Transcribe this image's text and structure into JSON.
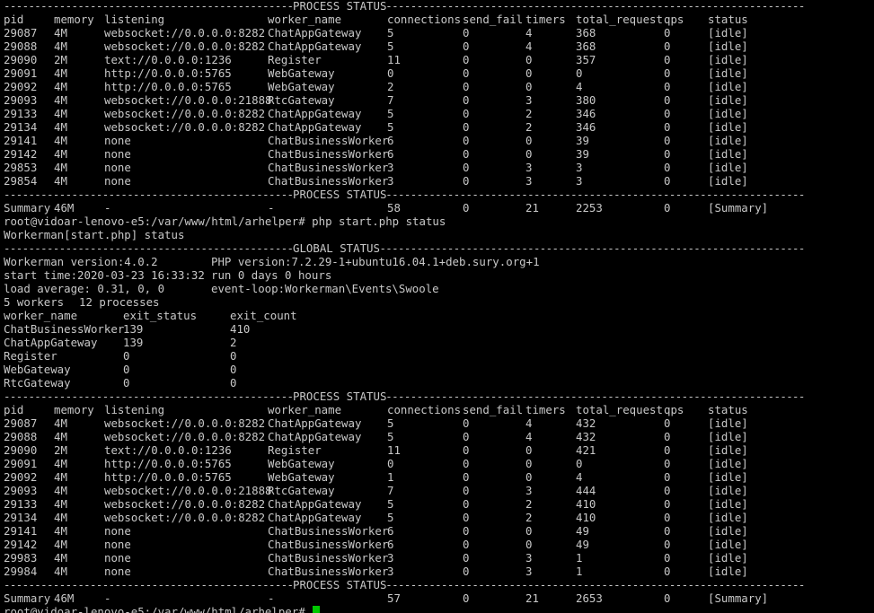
{
  "theme": {
    "background": "#000000",
    "foreground": "#c8c8c8",
    "cursor": "#00c800"
  },
  "process_status_header": "-------------------------------------------------PROCESS STATUS--------------------------------------------------",
  "global_status_header": "-------------------------------------------------GLOBAL STATUS--------------------------------------------------",
  "columns": [
    "pid",
    "memory",
    "listening",
    "worker_name",
    "connections",
    "send_fail",
    "timers",
    "total_request",
    "qps",
    "status"
  ],
  "table1": {
    "rows": [
      [
        "29087",
        "4M",
        "websocket://0.0.0.0:8282",
        "ChatAppGateway",
        "5",
        "0",
        "4",
        "368",
        "0",
        "[idle]"
      ],
      [
        "29088",
        "4M",
        "websocket://0.0.0.0:8282",
        "ChatAppGateway",
        "5",
        "0",
        "4",
        "368",
        "0",
        "[idle]"
      ],
      [
        "29090",
        "2M",
        "text://0.0.0.0:1236",
        "Register",
        "11",
        "0",
        "0",
        "357",
        "0",
        "[idle]"
      ],
      [
        "29091",
        "4M",
        "http://0.0.0.0:5765",
        "WebGateway",
        "0",
        "0",
        "0",
        "0",
        "0",
        "[idle]"
      ],
      [
        "29092",
        "4M",
        "http://0.0.0.0:5765",
        "WebGateway",
        "2",
        "0",
        "0",
        "4",
        "0",
        "[idle]"
      ],
      [
        "29093",
        "4M",
        "websocket://0.0.0.0:21888",
        "RtcGateway",
        "7",
        "0",
        "3",
        "380",
        "0",
        "[idle]"
      ],
      [
        "29133",
        "4M",
        "websocket://0.0.0.0:8282",
        "ChatAppGateway",
        "5",
        "0",
        "2",
        "346",
        "0",
        "[idle]"
      ],
      [
        "29134",
        "4M",
        "websocket://0.0.0.0:8282",
        "ChatAppGateway",
        "5",
        "0",
        "2",
        "346",
        "0",
        "[idle]"
      ],
      [
        "29141",
        "4M",
        "none",
        "ChatBusinessWorker",
        "6",
        "0",
        "0",
        "39",
        "0",
        "[idle]"
      ],
      [
        "29142",
        "4M",
        "none",
        "ChatBusinessWorker",
        "6",
        "0",
        "0",
        "39",
        "0",
        "[idle]"
      ],
      [
        "29853",
        "4M",
        "none",
        "ChatBusinessWorker",
        "3",
        "0",
        "3",
        "3",
        "0",
        "[idle]"
      ],
      [
        "29854",
        "4M",
        "none",
        "ChatBusinessWorker",
        "3",
        "0",
        "3",
        "3",
        "0",
        "[idle]"
      ]
    ],
    "summary": [
      "Summary",
      "46M",
      "-",
      "-",
      "58",
      "0",
      "21",
      "2253",
      "0",
      "[Summary]"
    ]
  },
  "prompt_command": "root@vidoar-lenovo-e5:/var/www/html/arhelper# php start.php status",
  "workerman_status_line": "Workerman[start.php] status",
  "global": {
    "workerman_version": "Workerman version:4.0.2",
    "php_version": "PHP version:7.2.29-1+ubuntu16.04.1+deb.sury.org+1",
    "start_time": "start time:2020-03-23 16:33:32",
    "run_time": "run 0 days 0 hours",
    "load_average": "load average: 0.31, 0, 0",
    "event_loop": "event-loop:Workerman\\Events\\Swoole",
    "workers": "5 workers",
    "processes": "12 processes",
    "exit_columns": [
      "worker_name",
      "exit_status",
      "exit_count"
    ],
    "exit_rows": [
      [
        "ChatBusinessWorker",
        "139",
        "410"
      ],
      [
        "ChatAppGateway",
        "139",
        "2"
      ],
      [
        "Register",
        "0",
        "0"
      ],
      [
        "WebGateway",
        "0",
        "0"
      ],
      [
        "RtcGateway",
        "0",
        "0"
      ]
    ]
  },
  "table2": {
    "rows": [
      [
        "29087",
        "4M",
        "websocket://0.0.0.0:8282",
        "ChatAppGateway",
        "5",
        "0",
        "4",
        "432",
        "0",
        "[idle]"
      ],
      [
        "29088",
        "4M",
        "websocket://0.0.0.0:8282",
        "ChatAppGateway",
        "5",
        "0",
        "4",
        "432",
        "0",
        "[idle]"
      ],
      [
        "29090",
        "2M",
        "text://0.0.0.0:1236",
        "Register",
        "11",
        "0",
        "0",
        "421",
        "0",
        "[idle]"
      ],
      [
        "29091",
        "4M",
        "http://0.0.0.0:5765",
        "WebGateway",
        "0",
        "0",
        "0",
        "0",
        "0",
        "[idle]"
      ],
      [
        "29092",
        "4M",
        "http://0.0.0.0:5765",
        "WebGateway",
        "1",
        "0",
        "0",
        "4",
        "0",
        "[idle]"
      ],
      [
        "29093",
        "4M",
        "websocket://0.0.0.0:21888",
        "RtcGateway",
        "7",
        "0",
        "3",
        "444",
        "0",
        "[idle]"
      ],
      [
        "29133",
        "4M",
        "websocket://0.0.0.0:8282",
        "ChatAppGateway",
        "5",
        "0",
        "2",
        "410",
        "0",
        "[idle]"
      ],
      [
        "29134",
        "4M",
        "websocket://0.0.0.0:8282",
        "ChatAppGateway",
        "5",
        "0",
        "2",
        "410",
        "0",
        "[idle]"
      ],
      [
        "29141",
        "4M",
        "none",
        "ChatBusinessWorker",
        "6",
        "0",
        "0",
        "49",
        "0",
        "[idle]"
      ],
      [
        "29142",
        "4M",
        "none",
        "ChatBusinessWorker",
        "6",
        "0",
        "0",
        "49",
        "0",
        "[idle]"
      ],
      [
        "29983",
        "4M",
        "none",
        "ChatBusinessWorker",
        "3",
        "0",
        "3",
        "1",
        "0",
        "[idle]"
      ],
      [
        "29984",
        "4M",
        "none",
        "ChatBusinessWorker",
        "3",
        "0",
        "3",
        "1",
        "0",
        "[idle]"
      ]
    ],
    "summary": [
      "Summary",
      "46M",
      "-",
      "-",
      "57",
      "0",
      "21",
      "2653",
      "0",
      "[Summary]"
    ]
  },
  "final_prompt": "root@vidoar-lenovo-e5:/var/www/html/arhelper#",
  "cursor_icon": "block-cursor"
}
